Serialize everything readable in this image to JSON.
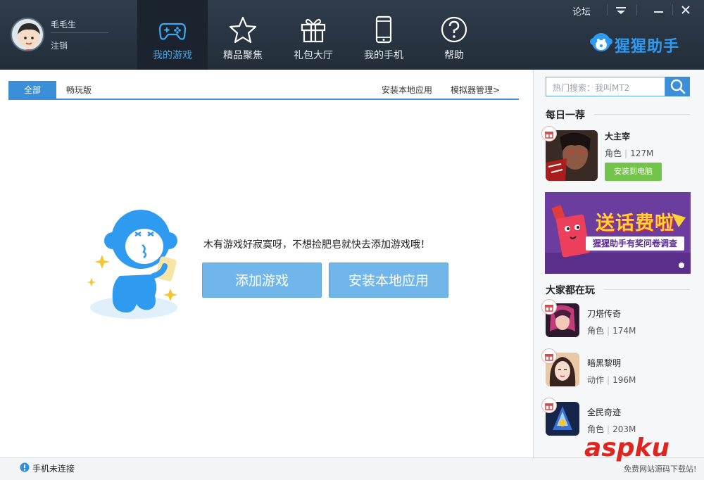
{
  "user": {
    "name": "毛毛生",
    "logout": "注销"
  },
  "nav": [
    {
      "label": "我的游戏",
      "icon": "gamepad-icon",
      "active": true
    },
    {
      "label": "精品聚焦",
      "icon": "star-icon"
    },
    {
      "label": "礼包大厅",
      "icon": "gift-icon"
    },
    {
      "label": "我的手机",
      "icon": "phone-icon"
    },
    {
      "label": "帮助",
      "icon": "help-icon"
    }
  ],
  "window": {
    "forum": "论坛"
  },
  "brand": {
    "name": "猩猩助手"
  },
  "tabs": {
    "all": "全部",
    "lite": "畅玩版",
    "install_local": "安装本地应用",
    "emulator": "模拟器管理>"
  },
  "empty": {
    "message": "木有游戏好寂寞呀，不想捡肥皂就快去添加游戏哦！",
    "add_button": "添加游戏",
    "install_button": "安装本地应用"
  },
  "sidebar": {
    "search_placeholder": "热门搜索：我叫MT2",
    "daily_title": "每日一荐",
    "daily_app": {
      "name": "大主宰",
      "category": "角色",
      "size": "127M",
      "install": "安装到电脑"
    },
    "banner": {
      "title": "送话费啦",
      "subtitle": "猩猩助手有奖问卷调查"
    },
    "popular_title": "大家都在玩",
    "popular": [
      {
        "name": "刀塔传奇",
        "category": "角色",
        "size": "174M"
      },
      {
        "name": "暗黑黎明",
        "category": "动作",
        "size": "196M"
      },
      {
        "name": "全民奇迹",
        "category": "角色",
        "size": "203M"
      }
    ]
  },
  "status": {
    "text": "手机未连接"
  },
  "watermark": {
    "main": "aspku",
    "sub": "免费网站源码下载站!"
  },
  "colors": {
    "accent": "#3b8fd9",
    "topbar": "#2a3541",
    "install_green": "#73c44b",
    "brand_blue": "#2e9bf0"
  }
}
